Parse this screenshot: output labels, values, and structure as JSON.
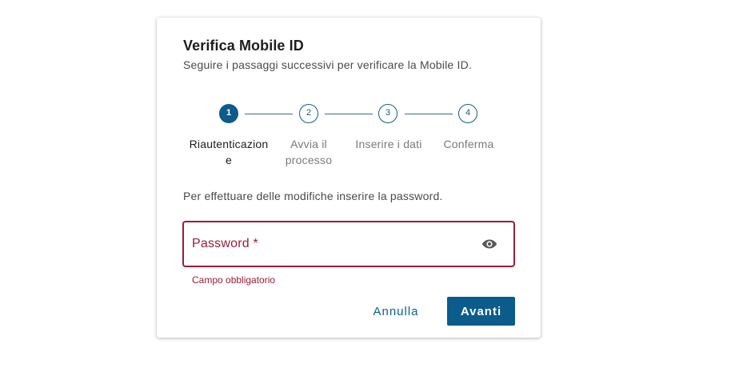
{
  "dialog": {
    "title": "Verifica Mobile ID",
    "subtitle": "Seguire i passaggi successivi per verificare la Mobile ID."
  },
  "stepper": {
    "active_step": 1,
    "steps": [
      {
        "number": "1",
        "label": "Riautenticazione"
      },
      {
        "number": "2",
        "label": "Avvia il processo"
      },
      {
        "number": "3",
        "label": "Inserire i dati"
      },
      {
        "number": "4",
        "label": "Conferma"
      }
    ]
  },
  "form": {
    "instruction": "Per effettuare delle modifiche inserire la password.",
    "password_label": "Password *",
    "password_value": "",
    "visibility_icon": "eye-icon",
    "error_text": "Campo obbligatorio"
  },
  "actions": {
    "cancel_label": "Annulla",
    "next_label": "Avanti"
  },
  "colors": {
    "primary": "#0b5c8a",
    "error": "#9b1c3a"
  }
}
